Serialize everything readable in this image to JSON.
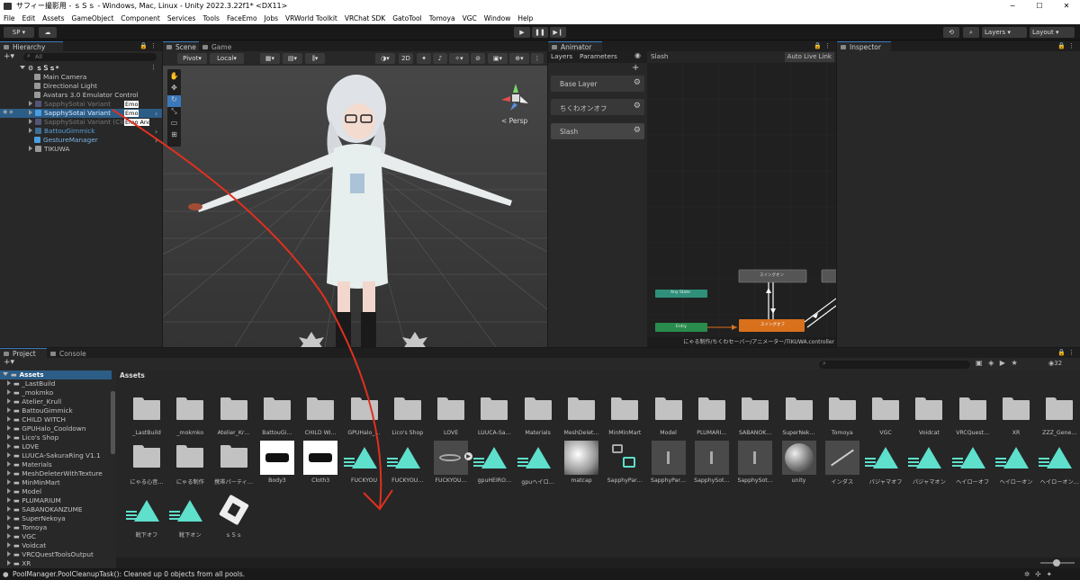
{
  "window": {
    "title": "サフィー撮影用 - ｓＳｓ - Windows, Mac, Linux - Unity 2022.3.22f1* <DX11>",
    "min": "─",
    "max": "☐",
    "close": "✕"
  },
  "menu": [
    "File",
    "Edit",
    "Assets",
    "GameObject",
    "Component",
    "Services",
    "Tools",
    "FaceEmo",
    "Jobs",
    "VRWorld Toolkit",
    "VRChat SDK",
    "GatoTool",
    "Tomoya",
    "VGC",
    "Window",
    "Help"
  ],
  "toolbar": {
    "account": "SP ▾",
    "layers": "Layers",
    "layout": "Layout"
  },
  "hierarchy": {
    "tab": "Hierarchy",
    "search_placeholder": "All",
    "scene": "ｓＳｓ*",
    "items": [
      {
        "label": "Main Camera"
      },
      {
        "label": "Directional Light"
      },
      {
        "label": "Avatars 3.0 Emulator Control"
      },
      {
        "label": "SapphySotai Variant"
      },
      {
        "label": "SapphySotai Variant"
      },
      {
        "label": "SapphySotai Variant (Clone)"
      },
      {
        "label": "BattouGimmick"
      },
      {
        "label": "GestureManager"
      },
      {
        "label": "TIKUWA"
      }
    ],
    "emo_badge": "Emo",
    "emo_badge_android": "Emo Android"
  },
  "scene": {
    "tab_scene": "Scene",
    "tab_game": "Game",
    "pivot": "Pivot",
    "local": "Local",
    "mode_2d": "2D",
    "persp": "< Persp"
  },
  "animator": {
    "tab": "Animator",
    "sub_layers": "Layers",
    "sub_parameters": "Parameters",
    "breadcrumb": "Slash",
    "auto_live_link": "Auto Live Link",
    "layers": [
      {
        "label": "Base Layer"
      },
      {
        "label": "ちくわオンオフ"
      },
      {
        "label": "Slash"
      }
    ],
    "nodes": {
      "any_state": "Any State",
      "entry": "Entry",
      "state_top": "スイングオン",
      "state_orange": "スイングオフ"
    },
    "path": "にゃる制作/ちくわセーバー/アニメーター/TIKUWA.controller"
  },
  "inspector": {
    "tab": "Inspector"
  },
  "project": {
    "tab_project": "Project",
    "tab_console": "Console",
    "root": "Assets",
    "breadcrumb": "Assets",
    "count": "32",
    "tree": [
      "_LastBuild",
      "_mokmko",
      "Atelier_Krull",
      "BattouGimmick",
      "CHILD WITCH",
      "GPUHalo_Cooldown",
      "Lico's Shop",
      "LOVE",
      "LUUCA-SakuraRing V1.1",
      "Materials",
      "MeshDeleterWithTexture",
      "MinMinMart",
      "Model",
      "PLUMARIUM",
      "SABANOKANZUME",
      "SuperNekoya",
      "Tomoya",
      "VGC",
      "Voidcat",
      "VRCQuestToolsOutput",
      "XR"
    ],
    "assets_row1": [
      "_LastBuild",
      "_mokmko",
      "Atelier_Kr…",
      "BattouGi…",
      "CHILD WI…",
      "GPUHalo_…",
      "Lico's Shop",
      "LOVE",
      "LUUCA-Sa…",
      "Materials",
      "MeshDelet…",
      "MinMinMart",
      "Model",
      "PLUMARI…",
      "SABANOK…",
      "SuperNek…",
      "Tomoya",
      "VGC",
      "Voidcat",
      "VRCQuest…",
      "XR",
      "ZZZ_Gene…"
    ],
    "assets_row2": [
      {
        "label": "にゃる心音…",
        "kind": "folder"
      },
      {
        "label": "にゃる制作",
        "kind": "folder"
      },
      {
        "label": "携帯パーティ…",
        "kind": "folder"
      },
      {
        "label": "Body3",
        "kind": "mesh"
      },
      {
        "label": "Cloth3",
        "kind": "mesh"
      },
      {
        "label": "FUCKYOU",
        "kind": "anim"
      },
      {
        "label": "FUCKYOU…",
        "kind": "anim"
      },
      {
        "label": "FUCKYOU…",
        "kind": "prefab"
      },
      {
        "label": "gpuHEIRO…",
        "kind": "anim"
      },
      {
        "label": "gpuヘイロ…",
        "kind": "anim"
      },
      {
        "label": "matcap",
        "kind": "texture"
      },
      {
        "label": "SapphyPar…",
        "kind": "params"
      },
      {
        "label": "SapphyPar…",
        "kind": "avatar"
      },
      {
        "label": "SapphySot…",
        "kind": "avatar"
      },
      {
        "label": "SapphySot…",
        "kind": "avatar"
      },
      {
        "label": "unity",
        "kind": "sphere"
      },
      {
        "label": "インダス",
        "kind": "line"
      },
      {
        "label": "パジャマオフ",
        "kind": "anim"
      },
      {
        "label": "パジャマオン",
        "kind": "anim"
      },
      {
        "label": "ヘイローオフ",
        "kind": "anim"
      },
      {
        "label": "ヘイローオン",
        "kind": "anim"
      },
      {
        "label": "ヘイローオン…",
        "kind": "anim"
      }
    ],
    "assets_row3": [
      {
        "label": "靴下オフ",
        "kind": "anim"
      },
      {
        "label": "靴下オン",
        "kind": "anim"
      },
      {
        "label": "ｓＳｓ",
        "kind": "unity"
      }
    ]
  },
  "status": {
    "message": "PoolManager.PoolCleanupTask(): Cleaned up 0 objects from all pools."
  },
  "colors": {
    "accent_teal": "#5ee0cc",
    "selection_blue": "#4a9de0",
    "annotation_red": "#e03020",
    "node_orange": "#d8701c",
    "node_green": "#2a8c4c"
  }
}
